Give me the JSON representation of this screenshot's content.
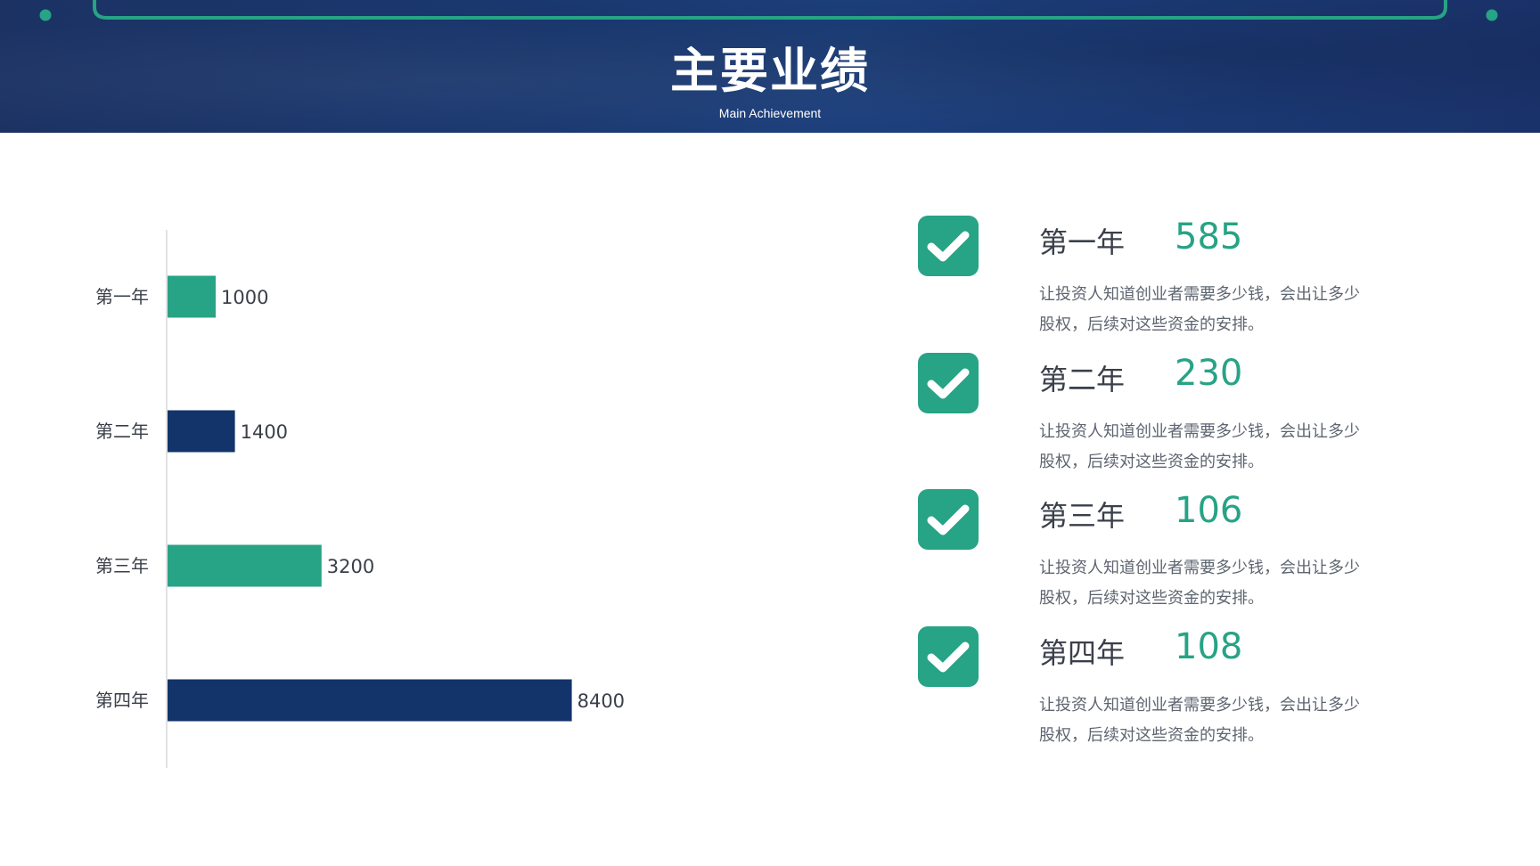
{
  "header": {
    "title": "主要业绩",
    "subtitle": "Main Achievement"
  },
  "colors": {
    "teal": "#27a385",
    "navy": "#13336b",
    "banner": "#1c3870",
    "text_dark": "#3a3f4a",
    "text_muted": "#5e6570"
  },
  "chart_data": {
    "type": "bar",
    "orientation": "horizontal",
    "categories": [
      "第一年",
      "第二年",
      "第三年",
      "第四年"
    ],
    "values": [
      1000,
      1400,
      3200,
      8400
    ],
    "bar_colors": [
      "#27a385",
      "#13336b",
      "#27a385",
      "#13336b"
    ],
    "xlim": [
      0,
      12000
    ],
    "grid": false,
    "title": "",
    "xlabel": "",
    "ylabel": ""
  },
  "achievements": [
    {
      "icon": "check-icon",
      "label": "第一年",
      "value": "585",
      "desc": "让投资人知道创业者需要多少钱，会出让多少股权，后续对这些资金的安排。"
    },
    {
      "icon": "check-icon",
      "label": "第二年",
      "value": "230",
      "desc": "让投资人知道创业者需要多少钱，会出让多少股权，后续对这些资金的安排。"
    },
    {
      "icon": "check-icon",
      "label": "第三年",
      "value": "106",
      "desc": "让投资人知道创业者需要多少钱，会出让多少股权，后续对这些资金的安排。"
    },
    {
      "icon": "check-icon",
      "label": "第四年",
      "value": "108",
      "desc": "让投资人知道创业者需要多少钱，会出让多少股权，后续对这些资金的安排。"
    }
  ]
}
